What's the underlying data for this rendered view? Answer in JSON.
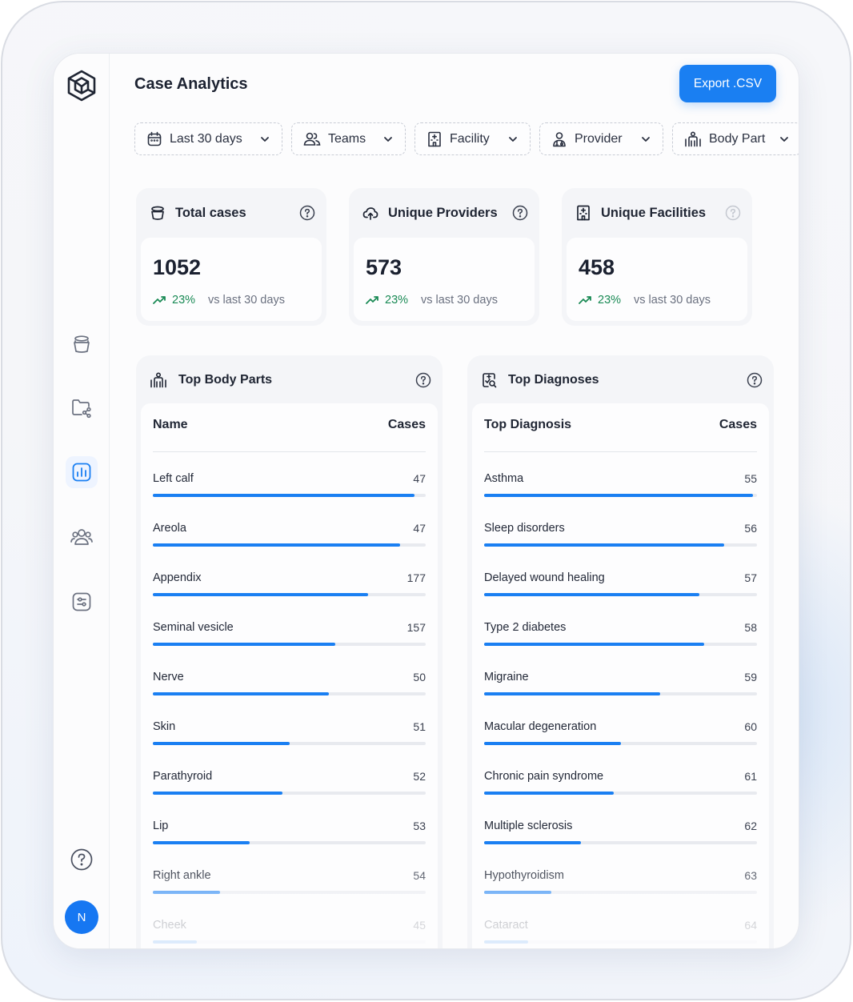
{
  "app": {
    "title": "Case Analytics",
    "export_label": "Export .CSV",
    "avatar_initial": "N",
    "accent_color": "#1a7ff2",
    "trend_color": "#1a8a55"
  },
  "filters": [
    {
      "label": "Last 30 days",
      "icon": "calendar-icon"
    },
    {
      "label": "Teams",
      "icon": "users-icon"
    },
    {
      "label": "Facility",
      "icon": "building-icon"
    },
    {
      "label": "Provider",
      "icon": "provider-icon"
    },
    {
      "label": "Body Part",
      "icon": "body-icon"
    }
  ],
  "stats": [
    {
      "title": "Total cases",
      "value": "1052",
      "trend": "23%",
      "trend_label": "vs last 30 days"
    },
    {
      "title": "Unique Providers",
      "value": "573",
      "trend": "23%",
      "trend_label": "vs last 30 days"
    },
    {
      "title": "Unique Facilities",
      "value": "458",
      "trend": "23%",
      "trend_label": "vs last 30 days"
    }
  ],
  "body_parts": {
    "title": "Top Body Parts",
    "col_name": "Name",
    "col_cases": "Cases",
    "rows": [
      {
        "name": "Left calf",
        "cases": "47",
        "progress": 0.96
      },
      {
        "name": "Areola",
        "cases": "47",
        "progress": 0.905
      },
      {
        "name": "Appendix",
        "cases": "177",
        "progress": 0.79
      },
      {
        "name": "Seminal vesicle",
        "cases": "157",
        "progress": 0.67
      },
      {
        "name": "Nerve",
        "cases": "50",
        "progress": 0.645
      },
      {
        "name": "Skin",
        "cases": "51",
        "progress": 0.5
      },
      {
        "name": "Parathyroid",
        "cases": "52",
        "progress": 0.475
      },
      {
        "name": "Lip",
        "cases": "53",
        "progress": 0.355
      },
      {
        "name": "Right ankle",
        "cases": "54",
        "progress": 0.245
      },
      {
        "name": "Cheek",
        "cases": "45",
        "progress": 0.16
      }
    ]
  },
  "diagnoses": {
    "title": "Top Diagnoses",
    "col_name": "Top Diagnosis",
    "col_cases": "Cases",
    "rows": [
      {
        "name": "Asthma",
        "cases": "55",
        "progress": 0.985
      },
      {
        "name": "Sleep disorders",
        "cases": "56",
        "progress": 0.88
      },
      {
        "name": "Delayed wound healing",
        "cases": "57",
        "progress": 0.79
      },
      {
        "name": "Type 2 diabetes",
        "cases": "58",
        "progress": 0.805
      },
      {
        "name": "Migraine",
        "cases": "59",
        "progress": 0.645
      },
      {
        "name": "Macular degeneration",
        "cases": "60",
        "progress": 0.5
      },
      {
        "name": "Chronic pain syndrome",
        "cases": "61",
        "progress": 0.475
      },
      {
        "name": "Multiple sclerosis",
        "cases": "62",
        "progress": 0.355
      },
      {
        "name": "Hypothyroidism",
        "cases": "63",
        "progress": 0.245
      },
      {
        "name": "Cataract",
        "cases": "64",
        "progress": 0.16
      }
    ]
  }
}
